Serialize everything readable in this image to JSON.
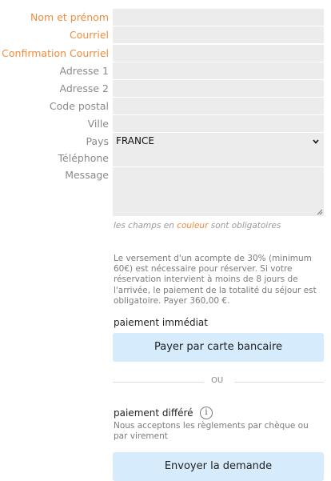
{
  "form": {
    "fields": [
      {
        "label": "Nom et prénom",
        "required": true,
        "value": ""
      },
      {
        "label": "Courriel",
        "required": true,
        "value": ""
      },
      {
        "label": "Confirmation Courriel",
        "required": true,
        "value": ""
      },
      {
        "label": "Adresse 1",
        "required": false,
        "value": ""
      },
      {
        "label": "Adresse 2",
        "required": false,
        "value": ""
      },
      {
        "label": "Code postal",
        "required": false,
        "value": ""
      },
      {
        "label": "Ville",
        "required": false,
        "value": ""
      }
    ],
    "country": {
      "label": "Pays",
      "selected": "FRANCE"
    },
    "phone": {
      "label": "Téléphone",
      "value": ""
    },
    "message": {
      "label": "Message",
      "value": ""
    },
    "required_note": {
      "before": "les champs en ",
      "colored_word": "couleur",
      "after": " sont obligatoires"
    }
  },
  "payment": {
    "deposit_text": "Le versement d'un acompte de 30% (minimum 60€) est nécessaire pour réserver. Si votre réservation intervient à moins de 8 jours de l'arrivée, le paiement de la totalité du séjour est obligatoire. Payer 360,00 €.",
    "immediate": {
      "title": "paiement immédiat",
      "button": "Payer par carte bancaire"
    },
    "separator": "OU",
    "deferred": {
      "title": "paiement différé",
      "info_icon_glyph": "i",
      "description": "Nous acceptons les règlements par chèque ou par virement",
      "button": "Envoyer la demande"
    }
  },
  "colors": {
    "required_label": "#f28c3c",
    "optional_label": "#8a8a8a",
    "field_bg": "#ececec",
    "button_bg": "#d6ebfb"
  }
}
